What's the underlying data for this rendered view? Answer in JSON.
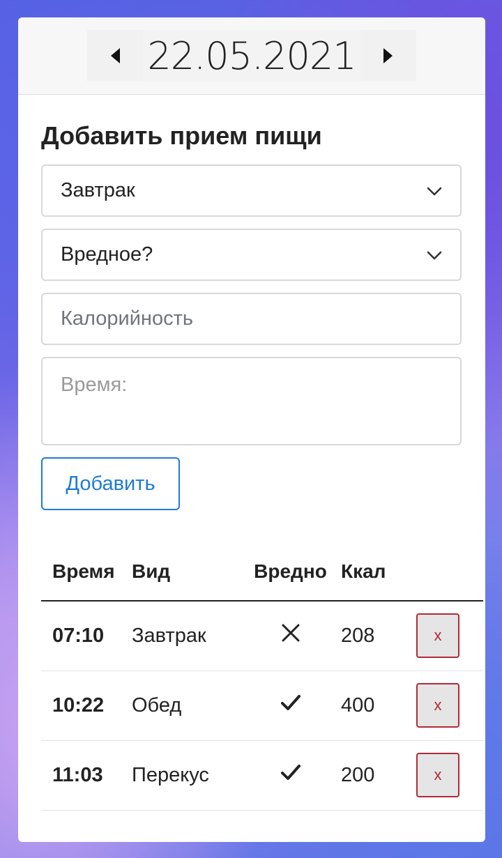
{
  "header": {
    "prev_label": "◀",
    "date": "22.05.2021",
    "next_label": "▶"
  },
  "form": {
    "title": "Добавить прием пищи",
    "meal_type_value": "Завтрак",
    "unhealthy_value": "Вредное?",
    "calories_placeholder": "Калорийность",
    "time_placeholder": "Время:",
    "submit_label": "Добавить"
  },
  "table": {
    "headers": [
      "Время",
      "Вид",
      "Вредно",
      "Ккал",
      ""
    ],
    "rows": [
      {
        "time": "07:10",
        "kind": "Завтрак",
        "unhealthy": false,
        "kcal": "208",
        "delete_label": "x"
      },
      {
        "time": "10:22",
        "kind": "Обед",
        "unhealthy": true,
        "kcal": "400",
        "delete_label": "x"
      },
      {
        "time": "11:03",
        "kind": "Перекус",
        "unhealthy": true,
        "kcal": "200",
        "delete_label": "x"
      }
    ]
  },
  "colors": {
    "accent": "#1e7bd6",
    "danger": "#b02a37"
  }
}
